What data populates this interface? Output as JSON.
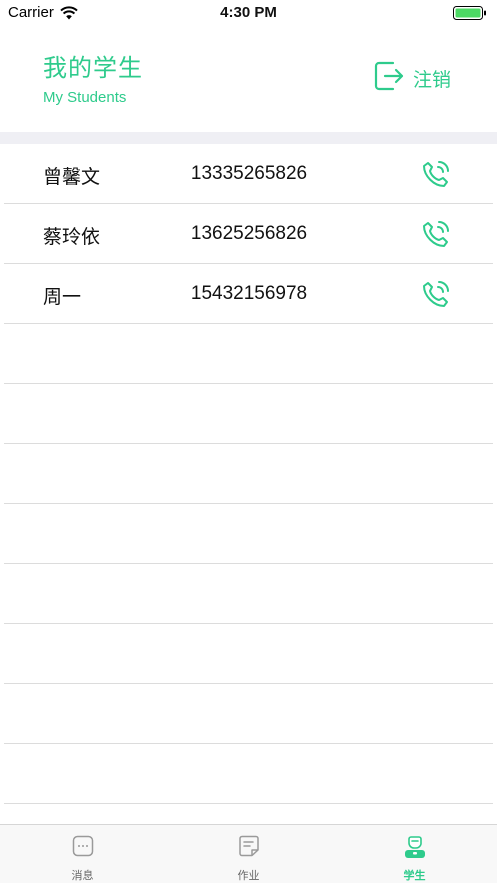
{
  "status_bar": {
    "carrier": "Carrier",
    "time": "4:30 PM"
  },
  "header": {
    "title_cn": "我的学生",
    "title_en": "My Students",
    "logout_label": "注销"
  },
  "students": [
    {
      "name": "曾馨文",
      "phone": "13335265826"
    },
    {
      "name": "蔡玲依",
      "phone": "13625256826"
    },
    {
      "name": "周一",
      "phone": "15432156978"
    }
  ],
  "tabbar": {
    "tabs": [
      {
        "label": "消息",
        "icon": "message-icon",
        "active": false
      },
      {
        "label": "作业",
        "icon": "homework-icon",
        "active": false
      },
      {
        "label": "学生",
        "icon": "student-icon",
        "active": true
      }
    ]
  },
  "colors": {
    "accent": "#2ecb8c",
    "divider": "#efeff4",
    "inactive": "#999999"
  }
}
